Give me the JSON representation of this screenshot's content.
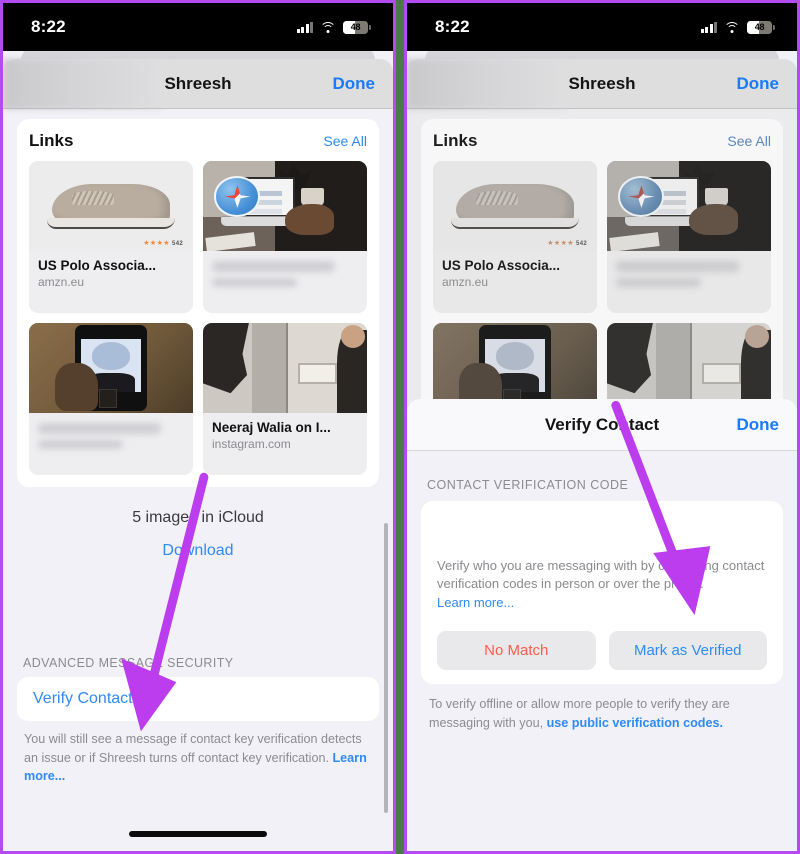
{
  "colors": {
    "accent_blue": "#2e8bf6",
    "nav_blue": "#1a7af8",
    "danger_red": "#fb5d4a",
    "arrow_purple": "#bb3ded",
    "panel_border": "#b24cf0",
    "gutter_green": "#4a7a4a",
    "page_bg": "#f2f1f7"
  },
  "panels": [
    {
      "id": "left",
      "status_bar": {
        "time": "8:22",
        "battery_level": "48",
        "cellular_icon": "cellular-bars-icon",
        "wifi_icon": "wifi-icon",
        "battery_icon": "battery-icon"
      },
      "navbar": {
        "title": "Shreesh",
        "done_label": "Done"
      },
      "links": {
        "title": "Links",
        "see_all_label": "See All",
        "tiles": [
          {
            "name": "US Polo Associa...",
            "host": "amzn.eu",
            "art": "shoe",
            "blurred": false,
            "rating": "★★★★",
            "rating_count": "542"
          },
          {
            "name": "",
            "host": "",
            "art": "desk",
            "blurred": true,
            "badge_icon": "safari-icon"
          },
          {
            "name": "",
            "host": "",
            "art": "phone",
            "blurred": true
          },
          {
            "name": "Neeraj Walia on I...",
            "host": "instagram.com",
            "art": "room",
            "blurred": false
          }
        ]
      },
      "icloud": {
        "count_label": "5 images in iCloud",
        "download_label": "Download"
      },
      "advanced_security": {
        "section_header": "ADVANCED MESSAGE SECURITY",
        "row_label": "Verify Contact...",
        "footer_text": "You will still see a message if contact key verification detects an issue or if Shreesh turns off contact key verification. ",
        "footer_link": "Learn more..."
      },
      "home_indicator": "home-indicator"
    },
    {
      "id": "right",
      "status_bar": {
        "time": "8:22",
        "battery_level": "48",
        "cellular_icon": "cellular-bars-icon",
        "wifi_icon": "wifi-icon",
        "battery_icon": "battery-icon"
      },
      "navbar": {
        "title": "Shreesh",
        "done_label": "Done"
      },
      "links": {
        "title": "Links",
        "see_all_label": "See All",
        "tiles": [
          {
            "name": "US Polo Associa...",
            "host": "amzn.eu",
            "art": "shoe",
            "blurred": false,
            "rating": "★★★★",
            "rating_count": "542"
          },
          {
            "name": "",
            "host": "",
            "art": "desk",
            "blurred": true,
            "badge_icon": "safari-icon"
          },
          {
            "name": "",
            "host": "",
            "art": "phone",
            "blurred": true
          },
          {
            "name": "",
            "host": "",
            "art": "room",
            "blurred": false
          }
        ]
      },
      "verify_sheet": {
        "title": "Verify Contact",
        "done_label": "Done",
        "section_label": "CONTACT VERIFICATION CODE",
        "description": "Verify who you are messaging with by comparing contact verification codes in person or over the phone. ",
        "description_link": "Learn more...",
        "buttons": [
          {
            "label": "No Match",
            "style": "danger"
          },
          {
            "label": "Mark as Verified",
            "style": "primary"
          }
        ],
        "footer_text": "To verify offline or allow more people to verify they are messaging with you, ",
        "footer_link": "use public verification codes."
      },
      "home_indicator": "home-indicator"
    }
  ]
}
